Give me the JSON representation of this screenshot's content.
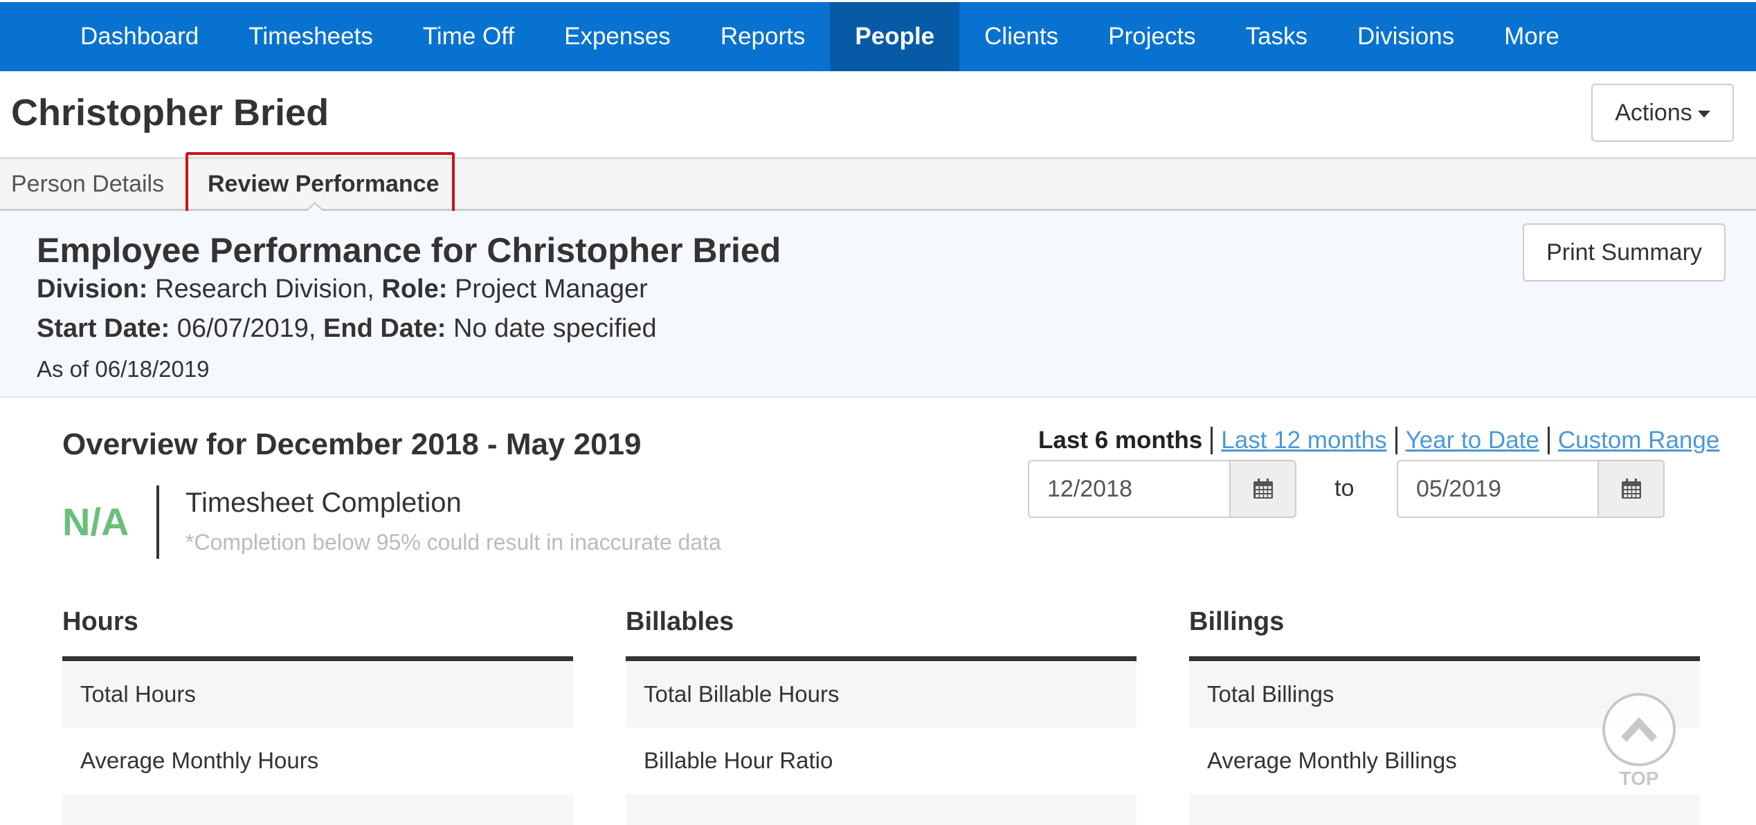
{
  "nav": {
    "items": [
      {
        "label": "Dashboard",
        "active": false
      },
      {
        "label": "Timesheets",
        "active": false
      },
      {
        "label": "Time Off",
        "active": false
      },
      {
        "label": "Expenses",
        "active": false
      },
      {
        "label": "Reports",
        "active": false
      },
      {
        "label": "People",
        "active": true
      },
      {
        "label": "Clients",
        "active": false
      },
      {
        "label": "Projects",
        "active": false
      },
      {
        "label": "Tasks",
        "active": false
      },
      {
        "label": "Divisions",
        "active": false
      },
      {
        "label": "More",
        "active": false
      }
    ]
  },
  "header": {
    "title": "Christopher Bried",
    "actions_label": "Actions"
  },
  "tabs": [
    {
      "label": "Person Details",
      "active": false
    },
    {
      "label": "Review Performance",
      "active": true
    }
  ],
  "summary": {
    "title": "Employee Performance for Christopher Bried",
    "division_label": "Division:",
    "division_value": "Research Division,",
    "role_label": "Role:",
    "role_value": "Project Manager",
    "start_label": "Start Date:",
    "start_value": "06/07/2019,",
    "end_label": "End Date:",
    "end_value": "No date specified",
    "as_of": "As of 06/18/2019",
    "print_label": "Print Summary"
  },
  "overview": {
    "prefix": "Overview for",
    "range_start": "December 2018",
    "dash": "-",
    "range_end": "May 2019",
    "completion_value": "N/A",
    "completion_label": "Timesheet Completion",
    "completion_note": "*Completion below 95% could result in inaccurate data",
    "ranges": [
      {
        "label": "Last 6 months",
        "current": true
      },
      {
        "label": "Last 12 months",
        "current": false
      },
      {
        "label": "Year to Date",
        "current": false
      },
      {
        "label": "Custom Range",
        "current": false
      }
    ],
    "from_date": "12/2018",
    "to_label": "to",
    "to_date": "05/2019"
  },
  "columns": [
    {
      "title": "Hours",
      "rows": [
        "Total Hours",
        "Average Monthly Hours"
      ]
    },
    {
      "title": "Billables",
      "rows": [
        "Total Billable Hours",
        "Billable Hour Ratio"
      ]
    },
    {
      "title": "Billings",
      "rows": [
        "Total Billings",
        "Average Monthly Billings"
      ]
    }
  ],
  "top_button": {
    "label": "TOP"
  },
  "colors": {
    "nav_bg": "#0872d1",
    "nav_active_bg": "#065aa6",
    "highlight": "#c9141a",
    "completion_green": "#6abf7b",
    "link": "#4a98d8"
  }
}
